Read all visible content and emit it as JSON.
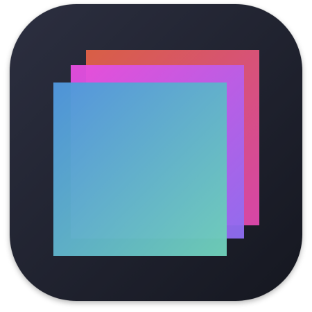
{
  "icon": {
    "name": "layered-squares-app-icon",
    "background_colors": [
      "#2c2f40",
      "#151720"
    ],
    "layers": [
      {
        "name": "back-layer",
        "colors": [
          "#d85f45",
          "#d646a8"
        ]
      },
      {
        "name": "middle-layer",
        "colors": [
          "#e94de0",
          "#8d6ef2"
        ]
      },
      {
        "name": "front-layer",
        "colors": [
          "#5096dd",
          "#6fcfb8"
        ]
      }
    ]
  }
}
